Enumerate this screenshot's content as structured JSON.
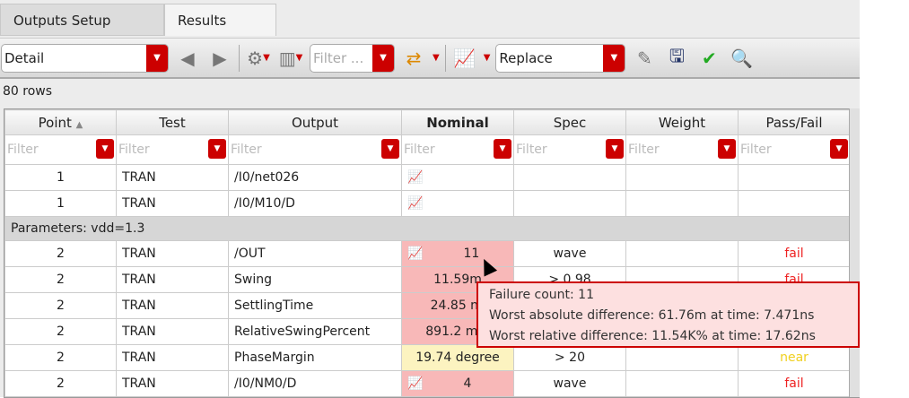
{
  "tabs": [
    "Outputs Setup",
    "Results"
  ],
  "toolbar": {
    "view": "Detail",
    "filter_placeholder": "Filter ...",
    "plot_mode": "Replace"
  },
  "row_count": "80 rows",
  "columns": [
    "Point",
    "Test",
    "Output",
    "Nominal",
    "Spec",
    "Weight",
    "Pass/Fail"
  ],
  "filter_placeholder": "Filter",
  "rows_a": [
    {
      "point": "1",
      "test": "TRAN",
      "output": "/I0/net026",
      "nominal": "",
      "spec": "",
      "pf": ""
    },
    {
      "point": "1",
      "test": "TRAN",
      "output": "/I0/M10/D",
      "nominal": "",
      "spec": "",
      "pf": ""
    }
  ],
  "param_row": "Parameters: vdd=1.3",
  "rows_b": [
    {
      "point": "2",
      "test": "TRAN",
      "output": "/OUT",
      "nominal": "11",
      "spec": "wave",
      "pf": "fail"
    },
    {
      "point": "2",
      "test": "TRAN",
      "output": "Swing",
      "nominal": "11.59m",
      "spec": "> 0.98",
      "pf": "fail"
    },
    {
      "point": "2",
      "test": "TRAN",
      "output": "SettlingTime",
      "nominal": "24.85 ns",
      "spec": "",
      "pf": ""
    },
    {
      "point": "2",
      "test": "TRAN",
      "output": "RelativeSwingPercent",
      "nominal": "891.2 m%",
      "spec": "",
      "pf": ""
    },
    {
      "point": "2",
      "test": "TRAN",
      "output": "PhaseMargin",
      "nominal": "19.74 degree",
      "spec": "> 20",
      "pf": "near"
    },
    {
      "point": "2",
      "test": "TRAN",
      "output": "/I0/NM0/D",
      "nominal": "4",
      "spec": "wave",
      "pf": "fail"
    }
  ],
  "tooltip": [
    "Failure count: 11",
    "Worst absolute difference: 61.76m at time: 7.471ns",
    "Worst relative difference: 11.54K% at time: 17.62ns"
  ]
}
